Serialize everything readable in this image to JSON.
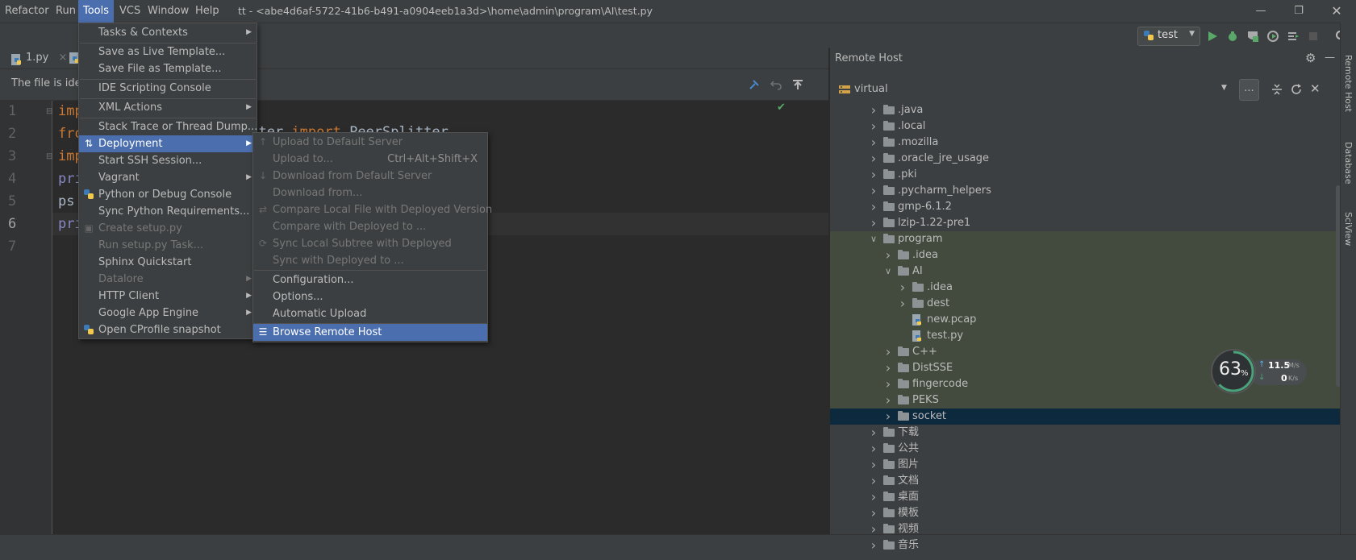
{
  "menubar": {
    "items": [
      "Refactor",
      "Run",
      "Tools",
      "VCS",
      "Window",
      "Help"
    ],
    "title": "tt - <abe4d6af-5722-41b6-b491-a0904eeb1a3d>\\home\\admin\\program\\AI\\test.py"
  },
  "toolbar": {
    "run_config": "test"
  },
  "editor": {
    "tabs": [
      "1.py"
    ],
    "notice": "The file is iden",
    "line_numbers": [
      "1",
      "2",
      "3",
      "4",
      "5",
      "6",
      "7"
    ],
    "code_lines": [
      [
        "imp",
        ""
      ],
      [
        "fro",
        ""
      ],
      [
        "imp",
        ""
      ],
      [
        "pri",
        ""
      ],
      [
        "ps",
        ""
      ],
      [
        "pri",
        ""
      ]
    ],
    "fragment": {
      "left": "itter ",
      "kw": "import",
      "right": " PeerSplitter"
    }
  },
  "tools_menu": {
    "items": [
      {
        "label": "Tasks & Contexts",
        "arrow": true
      },
      {
        "label": "Save as Live Template..."
      },
      {
        "label": "Save File as Template..."
      },
      {
        "label": "IDE Scripting Console"
      },
      {
        "label": "XML Actions",
        "arrow": true
      },
      {
        "label": "Stack Trace or Thread Dump..."
      },
      {
        "label": "Deployment",
        "arrow": true,
        "selected": true
      },
      {
        "label": "Start SSH Session..."
      },
      {
        "label": "Vagrant",
        "arrow": true
      },
      {
        "label": "Python or Debug Console"
      },
      {
        "label": "Sync Python Requirements..."
      },
      {
        "label": "Create setup.py",
        "disabled": true
      },
      {
        "label": "Run setup.py Task...",
        "disabled": true
      },
      {
        "label": "Sphinx Quickstart"
      },
      {
        "label": "Datalore",
        "disabled": true,
        "arrow": true
      },
      {
        "label": "HTTP Client",
        "arrow": true
      },
      {
        "label": "Google App Engine",
        "arrow": true
      },
      {
        "label": "Open CProfile snapshot"
      }
    ]
  },
  "deployment_menu": {
    "items": [
      {
        "label": "Upload to Default Server",
        "disabled": true
      },
      {
        "label": "Upload to...",
        "disabled": true,
        "shortcut": "Ctrl+Alt+Shift+X"
      },
      {
        "label": "Download from Default Server",
        "disabled": true
      },
      {
        "label": "Download from...",
        "disabled": true
      },
      {
        "label": "Compare Local File with Deployed Version",
        "disabled": true
      },
      {
        "label": "Compare with Deployed to ...",
        "disabled": true
      },
      {
        "label": "Sync Local Subtree with Deployed",
        "disabled": true
      },
      {
        "label": "Sync with Deployed to ...",
        "disabled": true
      },
      {
        "label": "Configuration..."
      },
      {
        "label": "Options..."
      },
      {
        "label": "Automatic Upload"
      },
      {
        "label": "Browse Remote Host",
        "selected": true
      }
    ]
  },
  "remote_host": {
    "title": "Remote Host",
    "server": "virtual",
    "more_button": "...",
    "tree": [
      {
        "name": ".java",
        "depth": 0,
        "type": "folder",
        "expanded": false
      },
      {
        "name": ".local",
        "depth": 0,
        "type": "folder",
        "expanded": false
      },
      {
        "name": ".mozilla",
        "depth": 0,
        "type": "folder",
        "expanded": false
      },
      {
        "name": ".oracle_jre_usage",
        "depth": 0,
        "type": "folder",
        "expanded": false
      },
      {
        "name": ".pki",
        "depth": 0,
        "type": "folder",
        "expanded": false
      },
      {
        "name": ".pycharm_helpers",
        "depth": 0,
        "type": "folder",
        "expanded": false
      },
      {
        "name": "gmp-6.1.2",
        "depth": 0,
        "type": "folder",
        "expanded": false
      },
      {
        "name": "lzip-1.22-pre1",
        "depth": 0,
        "type": "folder",
        "expanded": false
      },
      {
        "name": "program",
        "depth": 0,
        "type": "folder",
        "expanded": true,
        "highlight": true
      },
      {
        "name": ".idea",
        "depth": 1,
        "type": "folder",
        "expanded": false,
        "highlight": true
      },
      {
        "name": "AI",
        "depth": 1,
        "type": "folder",
        "expanded": true,
        "highlight": true
      },
      {
        "name": ".idea",
        "depth": 2,
        "type": "folder",
        "expanded": false,
        "highlight": true
      },
      {
        "name": "dest",
        "depth": 2,
        "type": "folder",
        "expanded": false,
        "highlight": true
      },
      {
        "name": "new.pcap",
        "depth": 2,
        "type": "file",
        "highlight": true
      },
      {
        "name": "test.py",
        "depth": 2,
        "type": "file",
        "highlight": true
      },
      {
        "name": "C++",
        "depth": 1,
        "type": "folder",
        "expanded": false,
        "highlight": true
      },
      {
        "name": "DistSSE",
        "depth": 1,
        "type": "folder",
        "expanded": false,
        "highlight": true
      },
      {
        "name": "fingercode",
        "depth": 1,
        "type": "folder",
        "expanded": false,
        "highlight": true
      },
      {
        "name": "PEKS",
        "depth": 1,
        "type": "folder",
        "expanded": false,
        "highlight": true
      },
      {
        "name": "socket",
        "depth": 1,
        "type": "folder",
        "expanded": false,
        "selected": true
      },
      {
        "name": "下载",
        "depth": 0,
        "type": "folder",
        "expanded": false
      },
      {
        "name": "公共",
        "depth": 0,
        "type": "folder",
        "expanded": false
      },
      {
        "name": "图片",
        "depth": 0,
        "type": "folder",
        "expanded": false
      },
      {
        "name": "文档",
        "depth": 0,
        "type": "folder",
        "expanded": false
      },
      {
        "name": "桌面",
        "depth": 0,
        "type": "folder",
        "expanded": false
      },
      {
        "name": "模板",
        "depth": 0,
        "type": "folder",
        "expanded": false
      },
      {
        "name": "视频",
        "depth": 0,
        "type": "folder",
        "expanded": false
      },
      {
        "name": "音乐",
        "depth": 0,
        "type": "folder",
        "expanded": false
      }
    ]
  },
  "side_tabs": [
    "Remote Host",
    "Database",
    "SciView"
  ],
  "speed_widget": {
    "percent": "63",
    "percent_unit": "%",
    "up": "11.5",
    "up_unit": "M/s",
    "down": "0",
    "down_unit": "K/s"
  },
  "colors": {
    "accent": "#4b6eaf",
    "highlight_row": "#434b3e",
    "selected_row": "#0d293e",
    "green": "#59a869"
  }
}
